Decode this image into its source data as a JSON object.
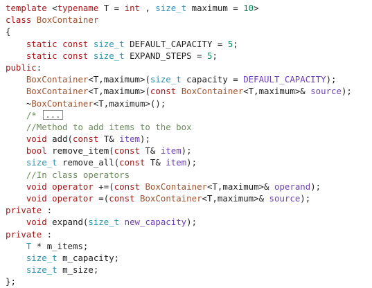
{
  "colors": {
    "keyword": "#a31515",
    "type": "#2b91af",
    "class_name": "#a0522d",
    "number": "#098658",
    "comment": "#6a8b5a",
    "param": "#6c3fb5",
    "text": "#1f1f1f"
  },
  "lines": [
    [
      [
        "kw",
        "template"
      ],
      [
        "plain",
        " <"
      ],
      [
        "kw",
        "typename"
      ],
      [
        "plain",
        " T = "
      ],
      [
        "kw",
        "int"
      ],
      [
        "plain",
        " , "
      ],
      [
        "type",
        "size_t"
      ],
      [
        "plain",
        " maximum = "
      ],
      [
        "num",
        "10"
      ],
      [
        "plain",
        ">"
      ]
    ],
    [
      [
        "kw",
        "class"
      ],
      [
        "plain",
        " "
      ],
      [
        "cls",
        "BoxContainer"
      ]
    ],
    [
      [
        "plain",
        "{"
      ]
    ],
    [
      [
        "plain",
        "    "
      ],
      [
        "kw",
        "static"
      ],
      [
        "plain",
        " "
      ],
      [
        "kw",
        "const"
      ],
      [
        "plain",
        " "
      ],
      [
        "type",
        "size_t"
      ],
      [
        "plain",
        " DEFAULT_CAPACITY = "
      ],
      [
        "num",
        "5"
      ],
      [
        "plain",
        ";"
      ]
    ],
    [
      [
        "plain",
        "    "
      ],
      [
        "kw",
        "static"
      ],
      [
        "plain",
        " "
      ],
      [
        "kw",
        "const"
      ],
      [
        "plain",
        " "
      ],
      [
        "type",
        "size_t"
      ],
      [
        "plain",
        " EXPAND_STEPS = "
      ],
      [
        "num",
        "5"
      ],
      [
        "plain",
        ";"
      ]
    ],
    [
      [
        "kw",
        "public"
      ],
      [
        "plain",
        ":"
      ]
    ],
    [
      [
        "plain",
        "    "
      ],
      [
        "cls",
        "BoxContainer"
      ],
      [
        "plain",
        "<T,maximum>("
      ],
      [
        "type",
        "size_t"
      ],
      [
        "plain",
        " capacity = "
      ],
      [
        "par",
        "DEFAULT_CAPACITY"
      ],
      [
        "plain",
        ");"
      ]
    ],
    [
      [
        "plain",
        "    "
      ],
      [
        "cls",
        "BoxContainer"
      ],
      [
        "plain",
        "<T,maximum>("
      ],
      [
        "kw",
        "const"
      ],
      [
        "plain",
        " "
      ],
      [
        "cls",
        "BoxContainer"
      ],
      [
        "plain",
        "<T,maximum>& "
      ],
      [
        "par",
        "source"
      ],
      [
        "plain",
        ");"
      ]
    ],
    [
      [
        "plain",
        "    ~"
      ],
      [
        "cls",
        "BoxContainer"
      ],
      [
        "plain",
        "<T,maximum>();"
      ]
    ],
    [
      [
        "plain",
        "    "
      ],
      [
        "cmt",
        "/* "
      ],
      [
        "fold",
        "..."
      ]
    ],
    [
      [
        "plain",
        "    "
      ],
      [
        "cmt",
        "//Method to add items to the box"
      ]
    ],
    [
      [
        "plain",
        "    "
      ],
      [
        "kw",
        "void"
      ],
      [
        "plain",
        " add("
      ],
      [
        "kw",
        "const"
      ],
      [
        "plain",
        " T& "
      ],
      [
        "par",
        "item"
      ],
      [
        "plain",
        ");"
      ]
    ],
    [
      [
        "plain",
        "    "
      ],
      [
        "kw",
        "bool"
      ],
      [
        "plain",
        " remove_item("
      ],
      [
        "kw",
        "const"
      ],
      [
        "plain",
        " T& "
      ],
      [
        "par",
        "item"
      ],
      [
        "plain",
        ");"
      ]
    ],
    [
      [
        "plain",
        "    "
      ],
      [
        "type",
        "size_t"
      ],
      [
        "plain",
        " remove_all("
      ],
      [
        "kw",
        "const"
      ],
      [
        "plain",
        " T& "
      ],
      [
        "par",
        "item"
      ],
      [
        "plain",
        ");"
      ]
    ],
    [
      [
        "plain",
        "    "
      ],
      [
        "cmt",
        "//In class operators"
      ]
    ],
    [
      [
        "plain",
        "    "
      ],
      [
        "kw",
        "void"
      ],
      [
        "plain",
        " "
      ],
      [
        "kw",
        "operator"
      ],
      [
        "plain",
        " +=("
      ],
      [
        "kw",
        "const"
      ],
      [
        "plain",
        " "
      ],
      [
        "cls",
        "BoxContainer"
      ],
      [
        "plain",
        "<T,maximum>& "
      ],
      [
        "par",
        "operand"
      ],
      [
        "plain",
        ");"
      ]
    ],
    [
      [
        "plain",
        "    "
      ],
      [
        "kw",
        "void"
      ],
      [
        "plain",
        " "
      ],
      [
        "kw",
        "operator"
      ],
      [
        "plain",
        " =("
      ],
      [
        "kw",
        "const"
      ],
      [
        "plain",
        " "
      ],
      [
        "cls",
        "BoxContainer"
      ],
      [
        "plain",
        "<T,maximum>& "
      ],
      [
        "par",
        "source"
      ],
      [
        "plain",
        ");"
      ]
    ],
    [
      [
        "kw",
        "private"
      ],
      [
        "plain",
        " :"
      ]
    ],
    [
      [
        "plain",
        "    "
      ],
      [
        "kw",
        "void"
      ],
      [
        "plain",
        " expand("
      ],
      [
        "type",
        "size_t"
      ],
      [
        "plain",
        " "
      ],
      [
        "par",
        "new_capacity"
      ],
      [
        "plain",
        ");"
      ]
    ],
    [
      [
        "kw",
        "private"
      ],
      [
        "plain",
        " :"
      ]
    ],
    [
      [
        "plain",
        "    "
      ],
      [
        "type",
        "T"
      ],
      [
        "plain",
        " * m_items;"
      ]
    ],
    [
      [
        "plain",
        "    "
      ],
      [
        "type",
        "size_t"
      ],
      [
        "plain",
        " m_capacity;"
      ]
    ],
    [
      [
        "plain",
        "    "
      ],
      [
        "type",
        "size_t"
      ],
      [
        "plain",
        " m_size;"
      ]
    ],
    [
      [
        "plain",
        "};"
      ]
    ]
  ]
}
